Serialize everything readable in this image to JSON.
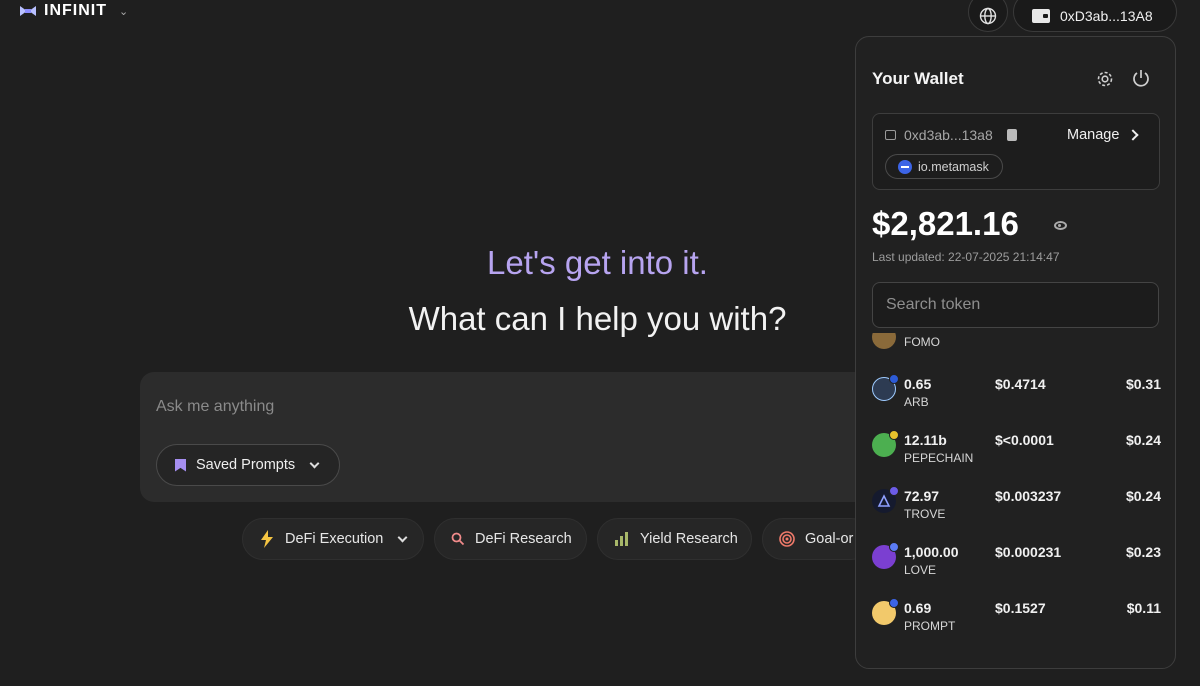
{
  "app": {
    "logo_text": "INFINIT"
  },
  "header": {
    "wallet_address": "0xD3ab...13A8"
  },
  "hero": {
    "line1": "Let's get into it.",
    "line2": "What can I help you with?"
  },
  "ask": {
    "placeholder": "Ask me anything",
    "saved_prompts_label": "Saved Prompts"
  },
  "chips": [
    {
      "label": "DeFi Execution",
      "icon": "lightning-icon"
    },
    {
      "label": "DeFi Research",
      "icon": "search-icon"
    },
    {
      "label": "Yield Research",
      "icon": "bar-chart-icon"
    },
    {
      "label": "Goal-or",
      "icon": "target-icon"
    }
  ],
  "wallet": {
    "title": "Your Wallet",
    "address": "0xd3ab...13a8",
    "manage_label": "Manage",
    "provider": "io.metamask",
    "balance": "$2,821.16",
    "last_updated": "Last updated: 22-07-2025 21:14:47",
    "search_placeholder": "Search token",
    "partial_token_symbol": "FOMO",
    "tokens": [
      {
        "amount": "0.65",
        "symbol": "ARB",
        "price": "$0.4714",
        "value": "$0.31",
        "color": "#2d3b52"
      },
      {
        "amount": "12.11b",
        "symbol": "PEPECHAIN",
        "price": "$<0.0001",
        "value": "$0.24",
        "color": "#4caf50"
      },
      {
        "amount": "72.97",
        "symbol": "TROVE",
        "price": "$0.003237",
        "value": "$0.24",
        "color": "#151a2e"
      },
      {
        "amount": "1,000.00",
        "symbol": "LOVE",
        "price": "$0.000231",
        "value": "$0.23",
        "color": "#7b3fd1"
      },
      {
        "amount": "0.69",
        "symbol": "PROMPT",
        "price": "$0.1527",
        "value": "$0.11",
        "color": "#f2c96b"
      }
    ]
  },
  "colors": {
    "accent": "#b7a4f0",
    "background": "#1f1f1f",
    "panel": "#212121"
  }
}
